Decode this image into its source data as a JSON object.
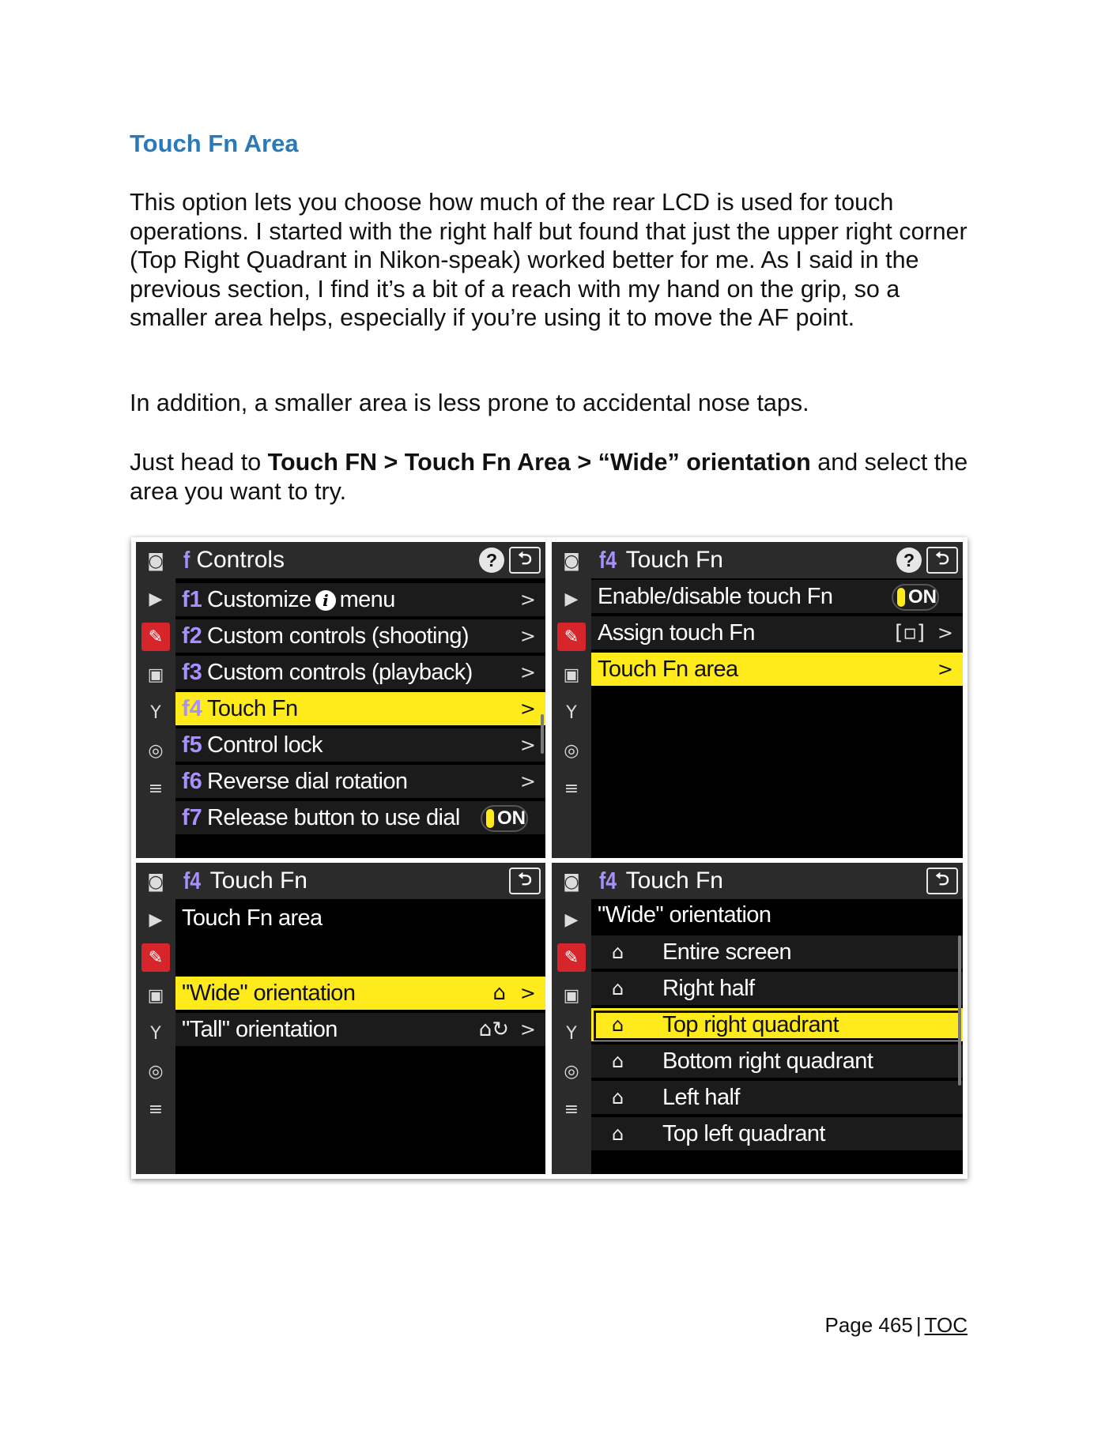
{
  "heading": "Touch Fn Area",
  "paragraphs": {
    "p1": "This option lets you choose how much of the rear LCD is used for touch operations. I started with the right half but found that just the upper right corner (Top Right Quadrant in Nikon-speak) worked better for me. As I said in the previous section, I find it’s a bit of a reach with my hand on the grip, so a smaller area helps, especially if you’re using it to move the AF point.",
    "p2": "In addition, a smaller area is less prone to accidental nose taps.",
    "p3_pre": "Just head to ",
    "p3_bold": "Touch FN > Touch Fn Area > “Wide” orientation",
    "p3_post": " and select the area you want to try."
  },
  "rail_icons": [
    "camera-icon",
    "movie-icon",
    "pencil-icon",
    "playback-icon",
    "wrench-icon",
    "network-icon",
    "mymenu-icon"
  ],
  "screen1": {
    "title_glyph": "f",
    "title": "Controls",
    "help": "?",
    "back": "⮌",
    "items": [
      {
        "code": "f1",
        "pre": "Customize",
        "badge": "i",
        "post": "menu",
        "arrow": ">"
      },
      {
        "code": "f2",
        "label": "Custom controls (shooting)",
        "arrow": ">"
      },
      {
        "code": "f3",
        "label": "Custom controls (playback)",
        "arrow": ">"
      },
      {
        "code": "f4",
        "label": "Touch Fn",
        "arrow": ">"
      },
      {
        "code": "f5",
        "label": "Control lock",
        "arrow": ">"
      },
      {
        "code": "f6",
        "label": "Reverse dial rotation",
        "arrow": ">"
      },
      {
        "code": "f7",
        "label": "Release button to use dial",
        "toggle": "ON"
      }
    ]
  },
  "screen2": {
    "title_glyph": "f4",
    "title": "Touch Fn",
    "help": "?",
    "back": "⮌",
    "items": [
      {
        "label": "Enable/disable touch Fn",
        "toggle": "ON"
      },
      {
        "label": "Assign touch Fn",
        "value": "[▫]",
        "arrow": ">"
      },
      {
        "label": "Touch Fn area",
        "arrow": ">"
      }
    ]
  },
  "screen3": {
    "title_glyph": "f4",
    "title": "Touch Fn",
    "back": "⮌",
    "subheading": "Touch Fn area",
    "items": [
      {
        "label": "\"Wide\" orientation",
        "value": "⌂",
        "arrow": ">"
      },
      {
        "label": "\"Tall\" orientation",
        "value": "⌂↻",
        "arrow": ">"
      }
    ]
  },
  "screen4": {
    "title_glyph": "f4",
    "title": "Touch Fn",
    "back": "⮌",
    "subheading": "\"Wide\" orientation",
    "items": [
      {
        "label": "Entire screen"
      },
      {
        "label": "Right half"
      },
      {
        "label": "Top right quadrant"
      },
      {
        "label": "Bottom right quadrant"
      },
      {
        "label": "Left half"
      },
      {
        "label": "Top left quadrant"
      }
    ]
  },
  "footer": {
    "page": "Page 465",
    "sep": "|",
    "toc": "TOC"
  }
}
